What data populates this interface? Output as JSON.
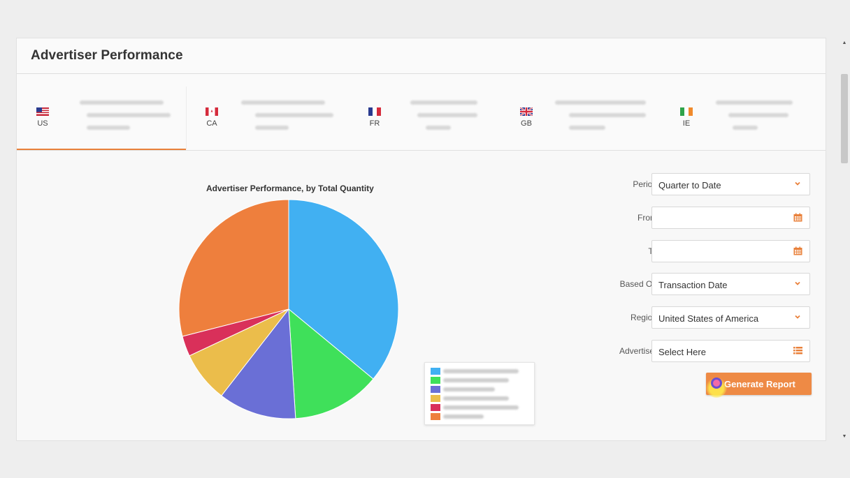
{
  "panel": {
    "title": "Advertiser Performance"
  },
  "tabs": [
    {
      "code": "US",
      "flag": "us-flag-icon",
      "active": true
    },
    {
      "code": "CA",
      "flag": "ca-flag-icon",
      "active": false
    },
    {
      "code": "FR",
      "flag": "fr-flag-icon",
      "active": false
    },
    {
      "code": "GB",
      "flag": "gb-flag-icon",
      "active": false
    },
    {
      "code": "IE",
      "flag": "ie-flag-icon",
      "active": false
    }
  ],
  "chart_data": {
    "type": "pie",
    "title": "Advertiser Performance, by Total Quantity",
    "slices": [
      {
        "value": 36.0,
        "color": "#41b0f2"
      },
      {
        "value": 13.0,
        "color": "#3fe05a"
      },
      {
        "value": 11.5,
        "color": "#6a6fd6"
      },
      {
        "value": 7.5,
        "color": "#ebbd4b"
      },
      {
        "value": 3.0,
        "color": "#d9305a"
      },
      {
        "value": 29.0,
        "color": "#ee7f3d"
      }
    ],
    "legend_visible": true,
    "legend_text_blurred": true
  },
  "form": {
    "period": {
      "label": "Period",
      "value": "Quarter to Date"
    },
    "from": {
      "label": "From",
      "value": ""
    },
    "to": {
      "label": "To",
      "value": ""
    },
    "based_on": {
      "label": "Based On",
      "value": "Transaction Date"
    },
    "region": {
      "label": "Region",
      "value": "United States of America"
    },
    "advertiser": {
      "label": "Advertiser",
      "value": "Select Here"
    }
  },
  "actions": {
    "generate_label": "Generate Report"
  },
  "colors": {
    "accent": "#e9803a",
    "button": "#ee8a45"
  }
}
